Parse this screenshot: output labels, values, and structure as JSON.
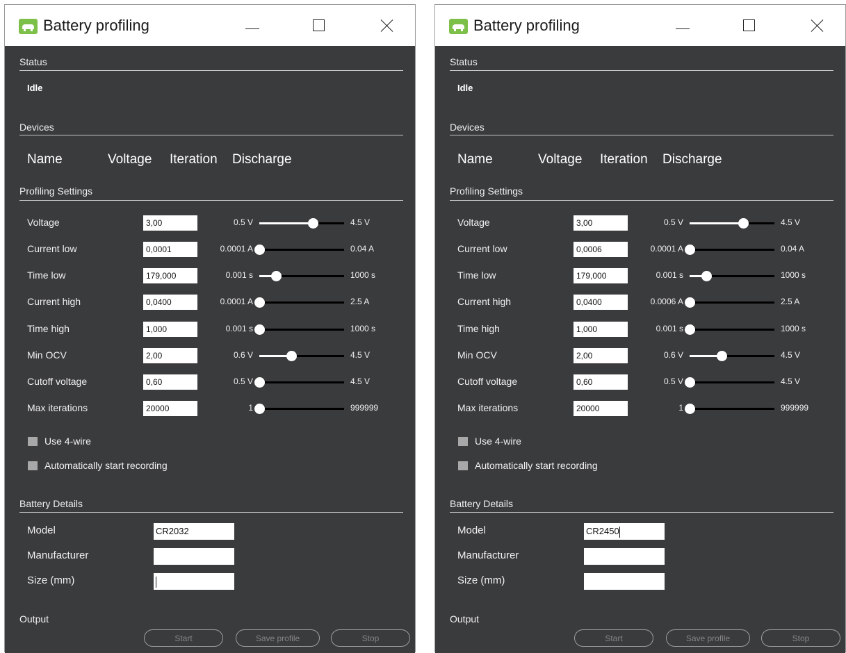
{
  "windows": [
    {
      "title": "Battery profiling",
      "status": {
        "header": "Status",
        "text": "Idle"
      },
      "devices": {
        "header": "Devices",
        "columns": [
          "Name",
          "Voltage",
          "Iteration",
          "Discharge"
        ]
      },
      "profiling": {
        "header": "Profiling Settings",
        "rows": [
          {
            "label": "Voltage",
            "value": "3,00",
            "min": "0.5 V",
            "max": "4.5 V",
            "level": 0.63
          },
          {
            "label": "Current low",
            "value": "0,0001",
            "min": "0.0001 A",
            "max": "0.04 A",
            "level": 0.0
          },
          {
            "label": "Time low",
            "value": "179,000",
            "min": "0.001 s",
            "max": "1000 s",
            "level": 0.2
          },
          {
            "label": "Current high",
            "value": "0,0400",
            "min": "0.0001 A",
            "max": "2.5 A",
            "level": 0.0
          },
          {
            "label": "Time high",
            "value": "1,000",
            "min": "0.001 s",
            "max": "1000 s",
            "level": 0.0
          },
          {
            "label": "Min OCV",
            "value": "2,00",
            "min": "0.6 V",
            "max": "4.5 V",
            "level": 0.38
          },
          {
            "label": "Cutoff voltage",
            "value": "0,60",
            "min": "0.5 V",
            "max": "4.5 V",
            "level": 0.0
          },
          {
            "label": "Max iterations",
            "value": "20000",
            "min": "1",
            "max": "999999",
            "level": 0.0
          }
        ],
        "checkboxes": [
          {
            "label": "Use 4-wire",
            "checked": false
          },
          {
            "label": "Automatically start recording",
            "checked": false
          }
        ]
      },
      "battery": {
        "header": "Battery Details",
        "fields": [
          {
            "label": "Model",
            "value": "CR2032",
            "caret": false
          },
          {
            "label": "Manufacturer",
            "value": "",
            "caret": false
          },
          {
            "label": "Size (mm)",
            "value": "",
            "caret": true
          }
        ]
      },
      "output": {
        "header": "Output"
      },
      "buttons": {
        "start": "Start",
        "save": "Save profile",
        "stop": "Stop"
      }
    },
    {
      "title": "Battery profiling",
      "status": {
        "header": "Status",
        "text": "Idle"
      },
      "devices": {
        "header": "Devices",
        "columns": [
          "Name",
          "Voltage",
          "Iteration",
          "Discharge"
        ]
      },
      "profiling": {
        "header": "Profiling Settings",
        "rows": [
          {
            "label": "Voltage",
            "value": "3,00",
            "min": "0.5 V",
            "max": "4.5 V",
            "level": 0.63
          },
          {
            "label": "Current low",
            "value": "0,0006",
            "min": "0.0001 A",
            "max": "0.04 A",
            "level": 0.0
          },
          {
            "label": "Time low",
            "value": "179,000",
            "min": "0.001 s",
            "max": "1000 s",
            "level": 0.2
          },
          {
            "label": "Current high",
            "value": "0,0400",
            "min": "0.0006 A",
            "max": "2.5 A",
            "level": 0.0
          },
          {
            "label": "Time high",
            "value": "1,000",
            "min": "0.001 s",
            "max": "1000 s",
            "level": 0.0
          },
          {
            "label": "Min OCV",
            "value": "2,00",
            "min": "0.6 V",
            "max": "4.5 V",
            "level": 0.38
          },
          {
            "label": "Cutoff voltage",
            "value": "0,60",
            "min": "0.5 V",
            "max": "4.5 V",
            "level": 0.0
          },
          {
            "label": "Max iterations",
            "value": "20000",
            "min": "1",
            "max": "999999",
            "level": 0.0
          }
        ],
        "checkboxes": [
          {
            "label": "Use 4-wire",
            "checked": false
          },
          {
            "label": "Automatically start recording",
            "checked": false
          }
        ]
      },
      "battery": {
        "header": "Battery Details",
        "fields": [
          {
            "label": "Model",
            "value": "CR2450",
            "caret": true
          },
          {
            "label": "Manufacturer",
            "value": "",
            "caret": false
          },
          {
            "label": "Size (mm)",
            "value": "",
            "caret": false
          }
        ]
      },
      "output": {
        "header": "Output"
      },
      "buttons": {
        "start": "Start",
        "save": "Save profile",
        "stop": "Stop"
      }
    }
  ],
  "colors": {
    "panel_bg": "#3a3b3d",
    "titlebar_bg": "#ffffff",
    "accent_icon": "#7cc04a",
    "text": "#f0f0f0",
    "separator": "#c8c8c8",
    "slider_track": "#000000",
    "slider_fill": "#ffffff",
    "checkbox": "#a8a8a8",
    "disabled_button_text": "#858585"
  },
  "icons": {
    "app": "battery-profiler-app-icon",
    "minimize": "minimize-icon",
    "maximize": "maximize-icon",
    "close": "close-icon"
  }
}
